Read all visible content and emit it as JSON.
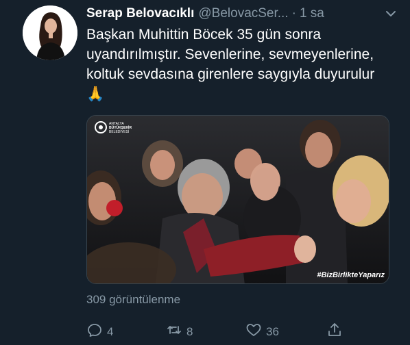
{
  "tweet": {
    "author_name": "Serap Belovacıklı",
    "handle": "@BelovacSer...",
    "separator": "·",
    "time": "1 sa",
    "text": "Başkan Muhittin Böcek 35 gün sonra uyandırılmıştır. Sevenlerine, sevmeyenlerine, koltuk sevdasına girenlere saygıyla duyurulur 🙏",
    "views": "309 görüntülenme",
    "replies": "4",
    "retweets": "8",
    "likes": "36"
  },
  "media": {
    "logo_line1": "ANTALYA",
    "logo_line2": "BÜYÜKŞEHİR",
    "logo_line3": "BELEDİYESİ",
    "hashtag": "#BizBirlikteYaparız"
  },
  "colors": {
    "background": "#15202b",
    "text_primary": "#ffffff",
    "text_secondary": "#8899a6",
    "border": "#38444d"
  },
  "icons": {
    "caret": "chevron-down-icon",
    "reply": "reply-icon",
    "retweet": "retweet-icon",
    "like": "heart-icon",
    "share": "share-icon"
  }
}
